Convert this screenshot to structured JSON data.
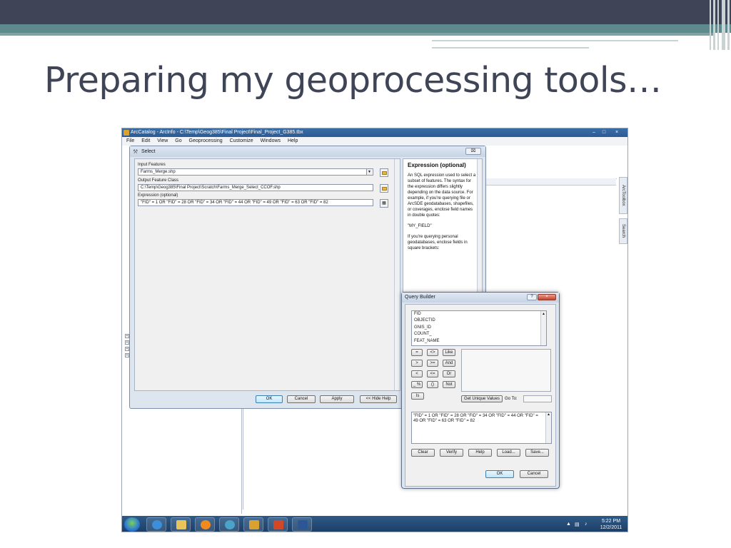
{
  "slide": {
    "title": "Preparing my geoprocessing tools…"
  },
  "window": {
    "title": "ArcCatalog - ArcInfo - C:\\Temp\\Geog385\\Final Project\\Final_Project_G385.tbx",
    "minimize": "–",
    "maximize": "□",
    "close": "×",
    "menu": [
      "File",
      "Edit",
      "View",
      "Go",
      "Geoprocessing",
      "Customize",
      "Windows",
      "Help"
    ],
    "side_tabs": [
      "ArcToolbox",
      "Search"
    ]
  },
  "select_dialog": {
    "title": "Select",
    "close": "⌧",
    "input_features_label": "Input Features",
    "input_features_value": "Farms_Merge.shp",
    "output_label": "Output Feature Class",
    "output_value": "C:\\Temp\\Geog385\\Final Project\\Scratch\\Farms_Merge_Select_CCOF.shp",
    "expression_label": "Expression (optional)",
    "expression_value": "\"FID\" = 1 OR \"FID\" = 28 OR \"FID\" = 34 OR \"FID\" = 44 OR \"FID\" = 49 OR \"FID\" = 63 OR \"FID\" = 82",
    "buttons": {
      "ok": "OK",
      "cancel": "Cancel",
      "apply": "Apply",
      "hide_help": "<< Hide Help"
    }
  },
  "help_panel": {
    "heading": "Expression (optional)",
    "para1": "An SQL expression used to select a subset of features. The syntax for the expression differs slightly depending on the data source. For example, if you're querying file or ArcSDE geodatabases, shapefiles, or coverages, enclose field names in double quotes:",
    "para2": "\"MY_FIELD\"",
    "para3": "If you're querying personal geodatabases, enclose fields in square brackets:"
  },
  "query_builder": {
    "title": "Query Builder",
    "help": "?",
    "close": "×",
    "fields": [
      "FID",
      "OBJECTID",
      "GNIS_ID",
      "COUNT_",
      "FEAT_NAME"
    ],
    "operators": [
      [
        "=",
        "<>",
        "Like"
      ],
      [
        ">",
        ">=",
        "And"
      ],
      [
        "<",
        "<=",
        "Or"
      ],
      [
        "_ %",
        "()",
        "Not"
      ]
    ],
    "is": "Is",
    "get_unique": "Get Unique Values",
    "go_to": "Go To:",
    "sql": "\"FID\" = 1 OR \"FID\" = 28 OR \"FID\" = 34 OR \"FID\" = 44 OR \"FID\" = 49 OR \"FID\" = 63 OR \"FID\" = 82",
    "buttons": {
      "clear": "Clear",
      "verify": "Verify",
      "help": "Help",
      "load": "Load...",
      "save": "Save...",
      "ok": "OK",
      "cancel": "Cancel"
    }
  },
  "taskbar": {
    "time": "5:22 PM",
    "date": "12/2/2011"
  }
}
